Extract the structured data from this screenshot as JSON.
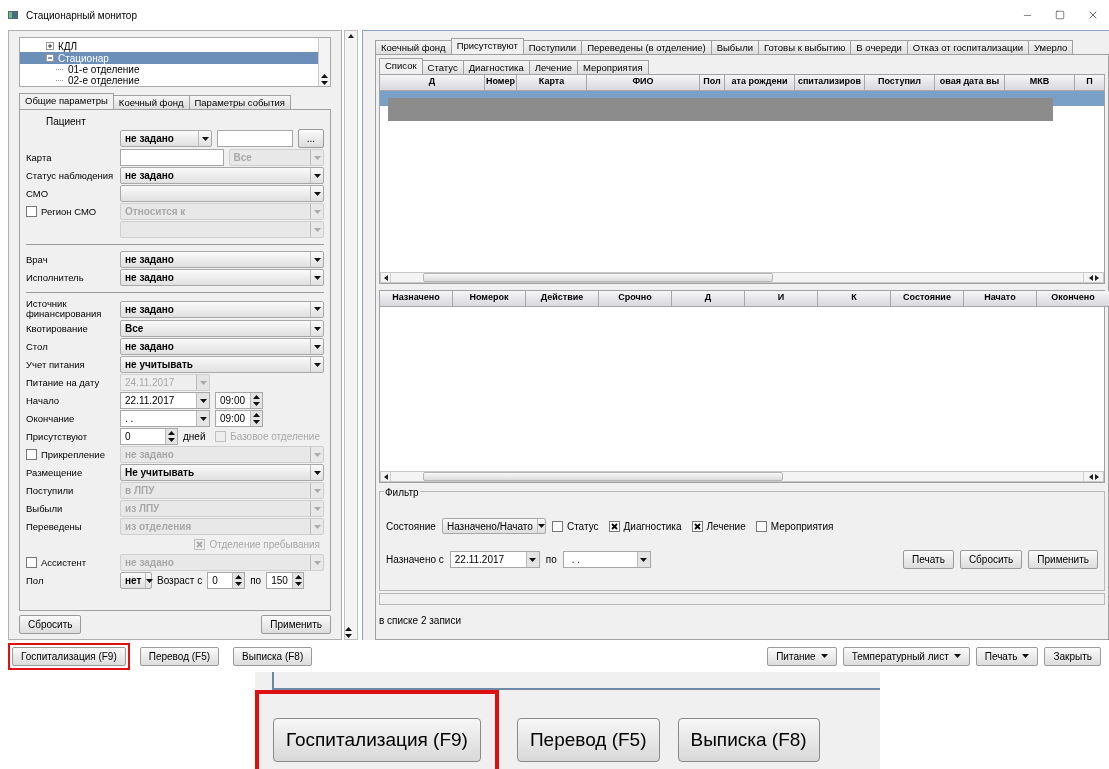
{
  "window": {
    "title": "Стационарный монитор"
  },
  "tree": [
    {
      "label": "КДЛ",
      "expanded": false,
      "selected": false
    },
    {
      "label": "Стационар",
      "expanded": true,
      "selected": true,
      "children": [
        {
          "label": "01-е отделение",
          "selected": false
        },
        {
          "label": "02-е отделение",
          "selected": false
        }
      ]
    }
  ],
  "left_tabs": [
    {
      "label": "Общие параметры",
      "selected": true
    },
    {
      "label": "Коечный фонд",
      "selected": false
    },
    {
      "label": "Параметры события",
      "selected": false
    }
  ],
  "form": {
    "heading": "Пациент",
    "rows": [
      {
        "kind": "field",
        "controls": [
          {
            "kind": "short_combo",
            "value": "не задано",
            "disabled": false
          },
          {
            "kind": "text",
            "disabled": false
          },
          {
            "kind": "button",
            "value": "..."
          }
        ]
      },
      {
        "kind": "field",
        "label": "Карта",
        "controls": [
          {
            "kind": "text",
            "disabled": false
          },
          {
            "kind": "combo",
            "value": "Все",
            "disabled": true
          }
        ]
      },
      {
        "kind": "field",
        "label": "Статус наблюдения",
        "controls": [
          {
            "kind": "combo",
            "value": "не задано",
            "disabled": false
          }
        ]
      },
      {
        "kind": "field",
        "label": "СМО",
        "controls": [
          {
            "kind": "combo",
            "disabled": false
          }
        ]
      },
      {
        "kind": "field",
        "label": "Регион СМО",
        "checked": false,
        "controls": [
          {
            "kind": "combo",
            "value": "Относится к",
            "disabled": true
          }
        ]
      },
      {
        "kind": "field",
        "controls": [
          {
            "kind": "combo",
            "disabled": true
          }
        ]
      },
      {
        "kind": "divider"
      },
      {
        "kind": "field",
        "label": "Врач",
        "controls": [
          {
            "kind": "combo",
            "value": "не задано",
            "disabled": false
          }
        ]
      },
      {
        "kind": "field",
        "label": "Исполнитель",
        "controls": [
          {
            "kind": "combo",
            "value": "не задано",
            "disabled": false
          }
        ]
      },
      {
        "kind": "divider"
      },
      {
        "kind": "field",
        "label": "Источник финансирования",
        "controls": [
          {
            "kind": "combo",
            "value": "не задано",
            "disabled": false
          }
        ]
      },
      {
        "kind": "field",
        "label": "Квотирование",
        "controls": [
          {
            "kind": "combo",
            "value": "Все",
            "disabled": false
          }
        ]
      },
      {
        "kind": "field",
        "label": "Стол",
        "controls": [
          {
            "kind": "combo",
            "value": "не задано",
            "disabled": false
          }
        ]
      },
      {
        "kind": "field",
        "label": "Учет питания",
        "controls": [
          {
            "kind": "combo",
            "value": "не учитывать",
            "disabled": false
          }
        ]
      },
      {
        "kind": "field",
        "label": "Питание на дату",
        "controls": [
          {
            "kind": "date",
            "value": "24.11.2017",
            "disabled": true
          }
        ]
      },
      {
        "kind": "field",
        "label": "Начало",
        "controls": [
          {
            "kind": "date",
            "value": "22.11.2017",
            "disabled": false
          },
          {
            "kind": "time",
            "value": "09:00",
            "disabled": false
          }
        ]
      },
      {
        "kind": "field",
        "label": "Окончание",
        "controls": [
          {
            "kind": "date",
            "value": ". .",
            "disabled": false
          },
          {
            "kind": "time",
            "value": "09:00",
            "disabled": false
          }
        ]
      },
      {
        "kind": "field",
        "label": "Присутствуют",
        "controls": [
          {
            "kind": "spin",
            "value": "0",
            "disabled": false
          },
          {
            "kind": "caption",
            "value": "дней"
          },
          {
            "kind": "check",
            "value": "Базовое отделение",
            "checked": false,
            "disabled": true
          }
        ]
      },
      {
        "kind": "field",
        "label": "Прикрепление",
        "checked": false,
        "controls": [
          {
            "kind": "combo",
            "value": "не задано",
            "disabled": true
          }
        ]
      },
      {
        "kind": "field",
        "label": "Размещение",
        "controls": [
          {
            "kind": "combo",
            "value": "Не учитывать",
            "disabled": false
          }
        ]
      },
      {
        "kind": "field",
        "label": "Поступили",
        "controls": [
          {
            "kind": "combo",
            "value": "в ЛПУ",
            "disabled": true
          }
        ]
      },
      {
        "kind": "field",
        "label": "Выбыли",
        "controls": [
          {
            "kind": "combo",
            "value": "из ЛПУ",
            "disabled": true
          }
        ]
      },
      {
        "kind": "field",
        "label": "Переведены",
        "controls": [
          {
            "kind": "combo",
            "value": "из отделения",
            "disabled": true
          }
        ]
      },
      {
        "kind": "field",
        "controls": [
          {
            "kind": "check",
            "value": "Отделение пребывания",
            "checked": true,
            "disabled": true
          }
        ]
      },
      {
        "kind": "field",
        "label": "Ассистент",
        "checked": false,
        "controls": [
          {
            "kind": "combo",
            "value": "не задано",
            "disabled": true
          }
        ]
      },
      {
        "kind": "field",
        "label": "Пол",
        "controls": [
          {
            "kind": "tiny_combo",
            "value": "нет",
            "disabled": false
          },
          {
            "kind": "caption",
            "value": "Возраст с"
          },
          {
            "kind": "small_spin",
            "value": "0",
            "disabled": false
          },
          {
            "kind": "caption",
            "value": "по"
          },
          {
            "kind": "small_spin",
            "value": "150",
            "disabled": false
          }
        ]
      }
    ]
  },
  "left_buttons": [
    "Сбросить",
    "Применить"
  ],
  "outer_tabs": [
    {
      "label": "Коечный фонд",
      "selected": false
    },
    {
      "label": "Присутствуют",
      "selected": true
    },
    {
      "label": "Поступили",
      "selected": false
    },
    {
      "label": "Переведены (в отделение)",
      "selected": false
    },
    {
      "label": "Выбыли",
      "selected": false
    },
    {
      "label": "Готовы к выбытию",
      "selected": false
    },
    {
      "label": "В очереди",
      "selected": false
    },
    {
      "label": "Отказ от госпитализации",
      "selected": false
    },
    {
      "label": "Умерло",
      "selected": false
    }
  ],
  "inner_tabs": [
    {
      "label": "Список",
      "selected": true
    },
    {
      "label": "Статус",
      "selected": false
    },
    {
      "label": "Диагностика",
      "selected": false
    },
    {
      "label": "Лечение",
      "selected": false
    },
    {
      "label": "Мероприятия",
      "selected": false
    }
  ],
  "main_table": {
    "columns": [
      "Д",
      "Номер",
      "Карта",
      "ФИО",
      "Пол",
      "ата рождени",
      "спитализиров",
      "Поступил",
      "овая дата вы",
      "МКВ",
      "П"
    ],
    "rows": [
      {
        "selected": true,
        "redacted": true
      },
      {
        "selected": false,
        "redacted": true
      }
    ]
  },
  "orders_table": {
    "columns": [
      "Назначено",
      "Номерок",
      "Действие",
      "Срочно",
      "Д",
      "И",
      "К",
      "Состояние",
      "Начато",
      "Окончено"
    ]
  },
  "filter": {
    "title": "Фильтр",
    "state_label": "Состояние",
    "state_value": "Назначено/Начато",
    "checks": [
      {
        "label": "Статус",
        "checked": false
      },
      {
        "label": "Диагностика",
        "checked": true
      },
      {
        "label": "Лечение",
        "checked": true
      },
      {
        "label": "Мероприятия",
        "checked": false
      }
    ],
    "from_label": "Назначено с",
    "from": "22.11.2017",
    "to_label": "по",
    "to": ". .",
    "buttons": [
      "Печать",
      "Сбросить",
      "Применить"
    ]
  },
  "status": "в списке 2 записи",
  "bottom_left": [
    {
      "label": "Госпитализация (F9)",
      "highlighted": true
    },
    {
      "label": "Перевод (F5)",
      "highlighted": false
    },
    {
      "label": "Выписка (F8)",
      "highlighted": false
    }
  ],
  "bottom_right": [
    {
      "label": "Питание",
      "menu": true
    },
    {
      "label": "Температурный лист",
      "menu": true
    },
    {
      "label": "Печать",
      "menu": true
    },
    {
      "label": "Закрыть",
      "menu": false
    }
  ],
  "callout": {
    "buttons": [
      {
        "label": "Госпитализация (F9)",
        "highlighted": true
      },
      {
        "label": "Перевод (F5)",
        "highlighted": false
      },
      {
        "label": "Выписка (F8)",
        "highlighted": false
      }
    ]
  }
}
